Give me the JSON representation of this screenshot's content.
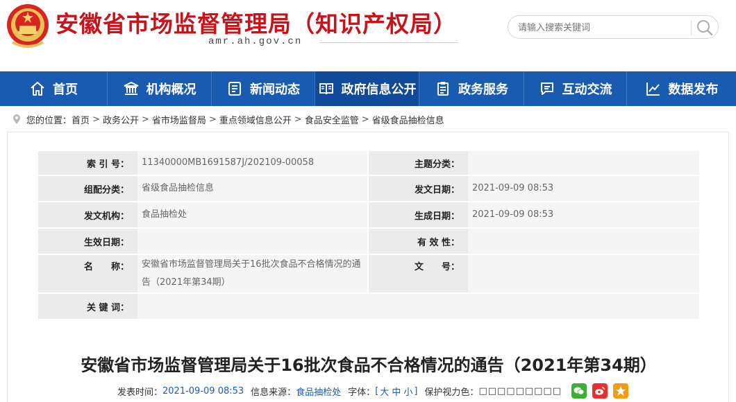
{
  "header": {
    "site_title": "安徽省市场监督管理局（知识产权局）",
    "domain": "amr.ah.gov.cn",
    "search_placeholder": "请输入搜索关键词"
  },
  "nav": {
    "items": [
      {
        "label": "首页",
        "icon": "home-icon"
      },
      {
        "label": "机构概况",
        "icon": "institution-icon"
      },
      {
        "label": "新闻动态",
        "icon": "newspaper-icon"
      },
      {
        "label": "政府信息公开",
        "icon": "open-book-icon"
      },
      {
        "label": "政务服务",
        "icon": "clipboard-icon"
      },
      {
        "label": "互动交流",
        "icon": "chat-icon"
      },
      {
        "label": "数据发布",
        "icon": "chart-icon"
      }
    ],
    "active_index": 3
  },
  "breadcrumb": {
    "prefix": "您的位置：",
    "items": [
      "首页",
      "政务公开",
      "省市场监督局",
      "重点领域信息公开",
      "食品安全监管",
      "省级食品抽检信息"
    ],
    "separator": ">"
  },
  "meta": {
    "index_label": "索 引 号：",
    "index_value": "11340000MB1691587J/202109-00058",
    "topic_label": "主题分类：",
    "topic_value": "",
    "category_label": "组配分类：",
    "category_value": "省级食品抽检信息",
    "issue_date_label": "发文日期：",
    "issue_date_value": "2021-09-09 08:53",
    "org_label": "发文机构：",
    "org_value": "食品抽检处",
    "created_label": "生成日期：",
    "created_value": "2021-09-09 08:53",
    "effective_label": "生效日期：",
    "effective_value": "",
    "validity_label": "有 效 性：",
    "validity_value": "",
    "name_label": "名　　称：",
    "name_value": "安徽省市场监督管理局关于16批次食品不合格情况的通告（2021年第34期）",
    "doc_no_label": "文　　号：",
    "doc_no_value": "",
    "keywords_label": "关 键 词：",
    "keywords_value": ""
  },
  "article": {
    "title": "安徽省市场监督管理局关于16批次食品不合格情况的通告（2021年第34期）",
    "publish_label": "发表时间：",
    "publish_time": "2021-09-09 08:53",
    "source_label": "信息来源：",
    "source_value": "食品抽检处",
    "font_label": "字体：",
    "font_open": "[",
    "font_large": "大",
    "font_medium": "中",
    "font_small": "小",
    "font_close": "]",
    "eye_label": "保护视力色：",
    "eye_swatches": "□□□□□□□□□"
  },
  "share": {
    "wechat_color": "#3cb034",
    "weibo_color": "#e8312f",
    "favorite_color": "#f39c12"
  },
  "colors": {
    "brand_red": "#c8131b",
    "nav_blue": "#1a5bb2"
  }
}
